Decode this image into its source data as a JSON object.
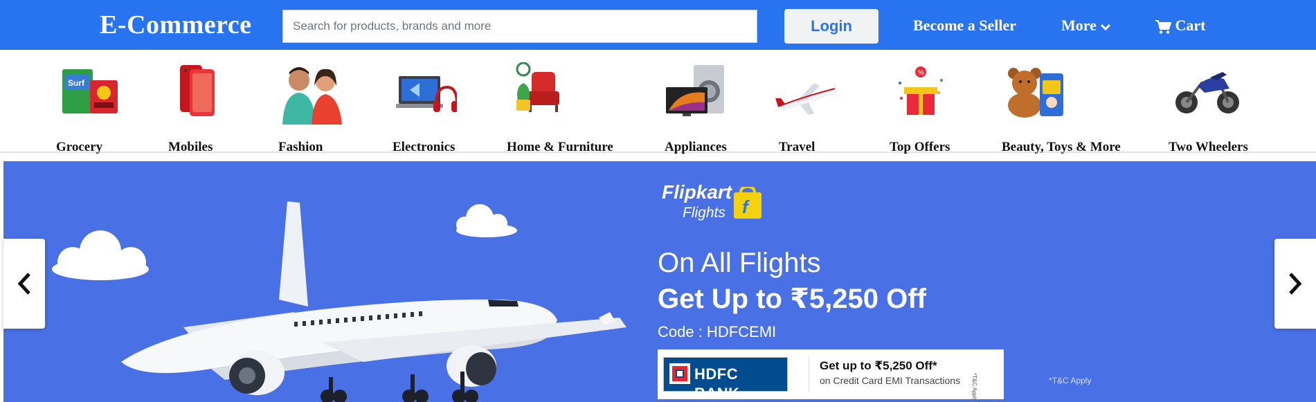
{
  "header": {
    "brand": "E-Commerce",
    "search_placeholder": "Search for products, brands and more",
    "login_label": "Login",
    "seller_label": "Become a Seller",
    "more_label": "More",
    "cart_label": "Cart",
    "colors": {
      "header_bg": "#2874f0",
      "login_text": "#2874f0"
    }
  },
  "categories": [
    {
      "label": "Grocery",
      "icon": "grocery-icon"
    },
    {
      "label": "Mobiles",
      "icon": "mobiles-icon"
    },
    {
      "label": "Fashion",
      "icon": "fashion-icon"
    },
    {
      "label": "Electronics",
      "icon": "electronics-icon"
    },
    {
      "label": "Home & Furniture",
      "icon": "furniture-icon"
    },
    {
      "label": "Appliances",
      "icon": "appliances-icon"
    },
    {
      "label": "Travel",
      "icon": "travel-icon"
    },
    {
      "label": "Top Offers",
      "icon": "offers-icon"
    },
    {
      "label": "Beauty, Toys & More",
      "icon": "toys-icon"
    },
    {
      "label": "Two Wheelers",
      "icon": "two-wheelers-icon"
    }
  ],
  "banner": {
    "brand_line1": "Flipkart",
    "brand_line2": "Flights",
    "headline": "On All Flights",
    "offer": "Get Up to ₹5,250 Off",
    "code": "Code : HDFCEMI",
    "bank_name": "HDFC BANK",
    "bank_offer": "Get up to ₹5,250 Off*",
    "bank_offer_sub": "on Credit Card EMI Transactions",
    "bank_tc": "*T&C Apply",
    "tc_note": "*T&C Apply",
    "colors": {
      "banner_bg": "#4a70e6"
    }
  }
}
